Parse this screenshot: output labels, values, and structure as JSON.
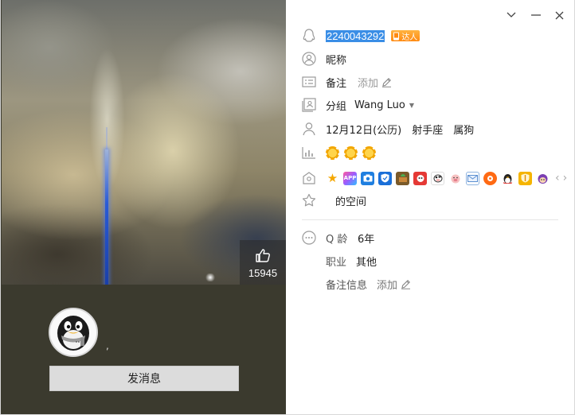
{
  "left": {
    "likes": "15945",
    "nickname_suffix": ",",
    "send_button_label": "发消息"
  },
  "window": {
    "collapse_icon": "chevron-down-icon",
    "minimize_icon": "minimize-icon",
    "close_icon": "close-icon"
  },
  "profile": {
    "qq_number": "2240043292",
    "talent_badge": "达人",
    "nickname": "昵称",
    "remark_label": "备注",
    "remark_action": "添加",
    "group_label": "分组",
    "group_value": "Wang Luo",
    "birthday": "12月12日(公历)",
    "zodiac": "射手座",
    "chinese_zodiac": "属狗",
    "level_icons": [
      "sun-icon",
      "sun-icon",
      "sun-icon"
    ],
    "services": [
      "star-icon",
      "app-icon",
      "camera-icon",
      "shield-icon",
      "farm-icon",
      "game-icon",
      "cow-icon",
      "pig-icon",
      "mail-icon",
      "music-icon",
      "penguin-icon",
      "security-icon",
      "pet-icon"
    ],
    "space_label": "的空间",
    "age_label": "Q 龄",
    "age_value": "6年",
    "job_label": "职业",
    "job_value": "其他",
    "remark_info_label": "备注信息",
    "remark_info_action": "添加"
  },
  "colors": {
    "highlight": "#3a8ee6",
    "left_panel_bg": "#3b3a2e",
    "button_bg": "#dcdcdc"
  }
}
